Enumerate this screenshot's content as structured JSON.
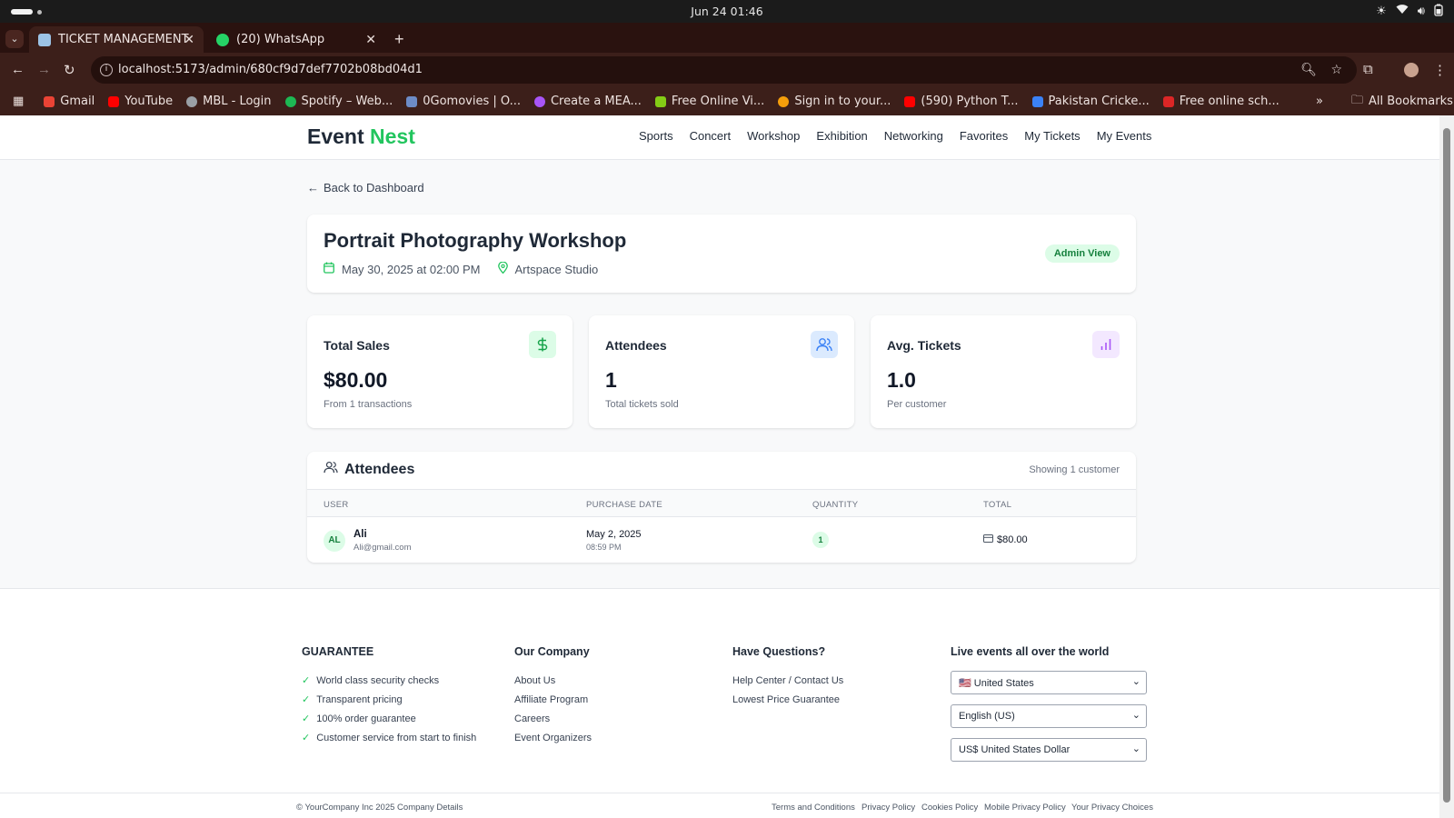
{
  "os": {
    "clock": "Jun 24  01:46"
  },
  "browser": {
    "tabs": [
      {
        "title": "TICKET MANAGEMENT",
        "active": true
      },
      {
        "title": "(20) WhatsApp",
        "active": false
      }
    ],
    "url": "localhost:5173/admin/680cf9d7def7702b08bd04d1",
    "bookmarks": [
      "Gmail",
      "YouTube",
      "MBL - Login",
      "Spotify – Web...",
      "0Gomovies | O...",
      "Create a MEA...",
      "Free Online Vi...",
      "Sign in to your...",
      "(590) Python T...",
      "Pakistan Cricke...",
      "Free online sch..."
    ],
    "all_bookmarks": "All Bookmarks"
  },
  "nav": {
    "logo_a": "Event",
    "logo_b": "Nest",
    "links": [
      "Sports",
      "Concert",
      "Workshop",
      "Exhibition",
      "Networking",
      "Favorites",
      "My Tickets",
      "My Events"
    ]
  },
  "back_label": "Back to Dashboard",
  "event": {
    "title": "Portrait Photography Workshop",
    "datetime": "May 30, 2025 at 02:00 PM",
    "venue": "Artspace Studio",
    "badge": "Admin View"
  },
  "stats": [
    {
      "label": "Total Sales",
      "value": "$80.00",
      "sub": "From 1 transactions",
      "icon": "dollar-icon",
      "color": "#22c55e"
    },
    {
      "label": "Attendees",
      "value": "1",
      "sub": "Total tickets sold",
      "icon": "users-icon",
      "color": "#3b82f6"
    },
    {
      "label": "Avg. Tickets",
      "value": "1.0",
      "sub": "Per customer",
      "icon": "bar-chart-icon",
      "color": "#a855f7"
    }
  ],
  "attendees": {
    "title": "Attendees",
    "showing": "Showing 1 customer",
    "columns": [
      "USER",
      "PURCHASE DATE",
      "QUANTITY",
      "TOTAL"
    ],
    "rows": [
      {
        "initials": "AL",
        "name": "Ali",
        "email": "Ali@gmail.com",
        "date": "May 2, 2025",
        "time": "08:59 PM",
        "qty": "1",
        "total": "$80.00"
      }
    ]
  },
  "footer": {
    "guarantee": {
      "title": "GUARANTEE",
      "items": [
        "World class security checks",
        "Transparent pricing",
        "100% order guarantee",
        "Customer service from start to finish"
      ]
    },
    "company": {
      "title": "Our Company",
      "items": [
        "About Us",
        "Affiliate Program",
        "Careers",
        "Event Organizers"
      ]
    },
    "questions": {
      "title": "Have Questions?",
      "items": [
        "Help Center / Contact Us",
        "Lowest Price Guarantee"
      ]
    },
    "live": {
      "title": "Live events all over the world",
      "country": "🇺🇸 United States",
      "language": "English (US)",
      "currency": "US$ United States Dollar"
    },
    "copyright": "© YourCompany Inc 2025 Company Details",
    "links": [
      "Terms and Conditions",
      "Privacy Policy",
      "Cookies Policy",
      "Mobile Privacy Policy",
      "Your Privacy Choices"
    ]
  }
}
